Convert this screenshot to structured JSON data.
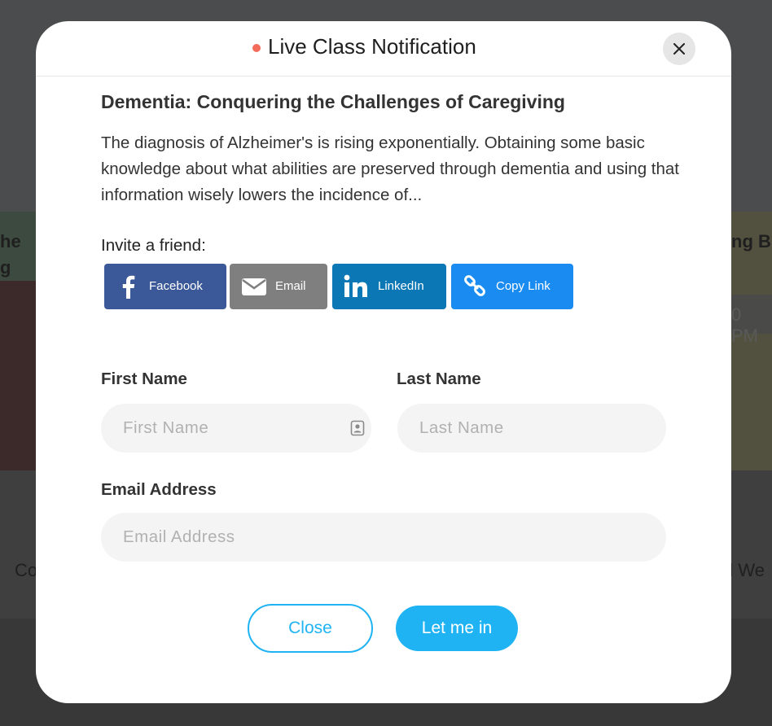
{
  "background": {
    "left_heading_line1": "he",
    "left_heading_line2": "g",
    "right_heading": "ng B",
    "right_time": "0 PM",
    "left_bottom_text": "Co",
    "right_bottom_text": "d We"
  },
  "modal": {
    "title": "Live Class Notification",
    "close_icon": "close-icon",
    "class_title": "Dementia: Conquering the Challenges of Caregiving",
    "class_description": "The diagnosis of Alzheimer's is rising exponentially. Obtaining some basic knowledge about what abilities are preserved through dementia and using that information wisely lowers the incidence of...",
    "invite_label": "Invite a friend:",
    "share_buttons": [
      {
        "label": "Facebook",
        "icon": "facebook-icon",
        "color": "#3b5998"
      },
      {
        "label": "Email",
        "icon": "envelope-icon",
        "color": "#7f7f7f"
      },
      {
        "label": "LinkedIn",
        "icon": "linkedin-icon",
        "color": "#0b77b5"
      },
      {
        "label": "Copy Link",
        "icon": "link-icon",
        "color": "#1a8bf0"
      }
    ],
    "form": {
      "first_name_label": "First Name",
      "first_name_placeholder": "First Name",
      "last_name_label": "Last Name",
      "last_name_placeholder": "Last Name",
      "email_label": "Email Address",
      "email_placeholder": "Email Address"
    },
    "actions": {
      "close_label": "Close",
      "submit_label": "Let me in"
    }
  },
  "colors": {
    "accent": "#1fb3f3",
    "live_dot": "#f36b5b"
  }
}
